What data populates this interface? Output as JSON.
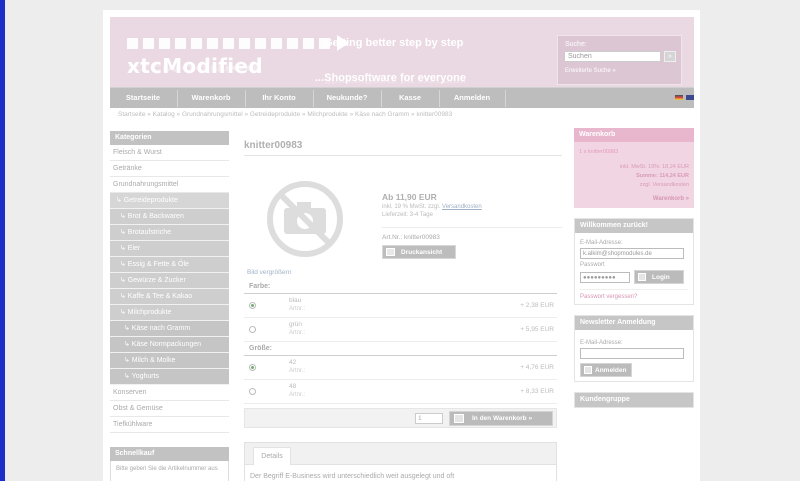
{
  "header": {
    "logo": "xtcModified",
    "tagline": "Getting better step by step",
    "subline": "...Shopsoftware for everyone"
  },
  "search": {
    "label": "Suche:",
    "value": "Suchen",
    "go": "»",
    "advanced": "Erweiterte Suche »"
  },
  "nav": [
    "Startseite",
    "Warenkorb",
    "Ihr Konto",
    "Neukunde?",
    "Kasse",
    "Anmelden"
  ],
  "breadcrumb": "Startseite » Katalog » Grundnahrungsmittel » Getreideprodukte » Milchprodukte » Käse nach Gramm » knitter00983",
  "categories": {
    "title": "Kategorien",
    "items": [
      {
        "label": "Fleisch & Wurst",
        "level": 0
      },
      {
        "label": "Getränke",
        "level": 0
      },
      {
        "label": "Grundnahrungsmittel",
        "level": 0
      },
      {
        "label": "↳ Getreideprodukte",
        "level": 1
      },
      {
        "label": "↳ Brot & Backwaren",
        "level": 2
      },
      {
        "label": "↳ Brotaufstriche",
        "level": 2
      },
      {
        "label": "↳ Eier",
        "level": 2
      },
      {
        "label": "↳ Essig & Fette & Öle",
        "level": 2
      },
      {
        "label": "↳ Gewürze & Zucker",
        "level": 2
      },
      {
        "label": "↳ Kaffe & Tee & Kakao",
        "level": 2
      },
      {
        "label": "↳ Milchprodukte",
        "level": 2
      },
      {
        "label": "↳ Käse nach Gramm",
        "level": 3
      },
      {
        "label": "↳ Käse Normpackungen",
        "level": 3
      },
      {
        "label": "↳ Milch & Molke",
        "level": 3
      },
      {
        "label": "↳ Yoghurts",
        "level": 3
      },
      {
        "label": "Konserven",
        "level": 0
      },
      {
        "label": "Obst & Gemüse",
        "level": 0
      },
      {
        "label": "Tiefkühlware",
        "level": 0
      }
    ]
  },
  "schnellkauf": {
    "title": "Schnellkauf",
    "text": "Bitte geben Sie die Artikelnummer aus"
  },
  "product": {
    "title": "knitter00983",
    "image_link": "Bild vergrößern",
    "price": "Ab 11,90 EUR",
    "tax_text": "inkl. 19 % MwSt. zzgl.",
    "shipping_link": "Versandkosten",
    "delivery": "Lieferzeit: 3-4 Tage",
    "art_nr": "Art.Nr.: knitter00983",
    "print_button": "Druckansicht"
  },
  "options": [
    {
      "title": "Farbe:",
      "rows": [
        {
          "name": "blau",
          "artnr": "Artnr.:",
          "price": "+ 2,38 EUR",
          "selected": true
        },
        {
          "name": "grün",
          "artnr": "Artnr.:",
          "price": "+ 5,95 EUR",
          "selected": false
        }
      ]
    },
    {
      "title": "Größe:",
      "rows": [
        {
          "name": "42",
          "artnr": "Artnr.:",
          "price": "+ 4,76 EUR",
          "selected": true
        },
        {
          "name": "48",
          "artnr": "Artnr.:",
          "price": "+ 8,33 EUR",
          "selected": false
        }
      ]
    }
  ],
  "cart": {
    "qty": "1",
    "button": "In den Warenkorb »"
  },
  "details": {
    "tab": "Details",
    "text": "Der Begriff E-Business wird unterschiedlich weit ausgelegt und oft"
  },
  "warenkorb": {
    "title": "Warenkorb",
    "item": "1 x knitter00983",
    "mwst": "inkl. MwSt. 19%: 18,24 EUR",
    "summe": "Summe: 114,24 EUR",
    "shipping": "zzgl. Versandkosten",
    "link": "Warenkorb »"
  },
  "login": {
    "title": "Willkommen zurück!",
    "email_label": "E-Mail-Adresse:",
    "email_value": "k.alkim@shopmodules.de",
    "password_label": "Passwort",
    "password_value": "●●●●●●●●●",
    "button": "Login",
    "forgot": "Passwort vergessen?"
  },
  "newsletter": {
    "title": "Newsletter Anmeldung",
    "email_label": "E-Mail-Adresse:",
    "button": "Anmelden"
  },
  "kundengruppe": {
    "title": "Kundengruppe"
  }
}
